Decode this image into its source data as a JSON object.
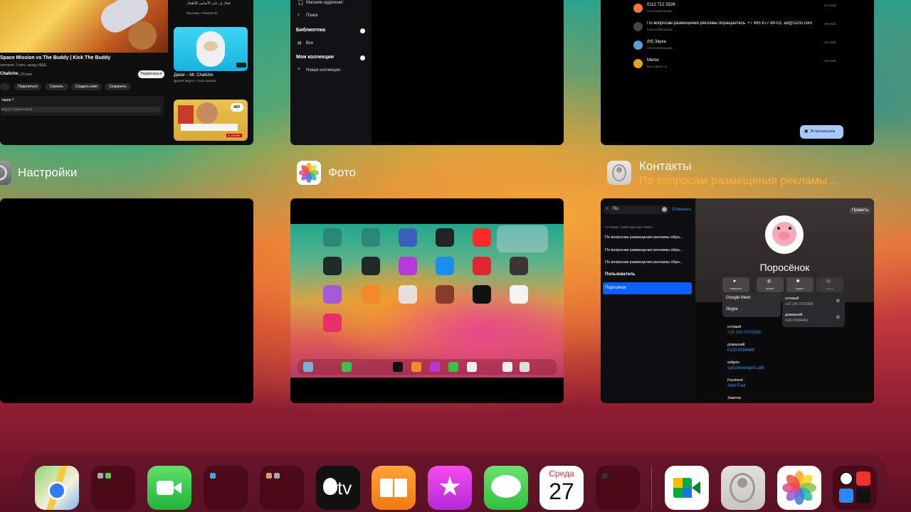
{
  "apps": {
    "youtube": {
      "video_title": "Space Mission vs The Buddy | Kick The Buddy",
      "video_meta": "смотров: 2 млн, назад #ЩЩ",
      "channel": "Chaliche",
      "channel_subs": "1,29 млн",
      "subscribe": "Подписаться",
      "actions": [
        "Поделиться",
        "Скачать",
        "Создать клип",
        "Сохранить"
      ],
      "comments": "тарии 7",
      "comment_placeholder": "ведите комментарий",
      "side_top_text": "فعال إن على الأساس للأطفال",
      "side_top_meta": "Реклама • Parasol 00",
      "side_video_title": "Джем – Mr. Chaliche",
      "side_video_meta": "Другие видео с этого канала",
      "live_badge": "В ЭФИРЕ",
      "no_badge": "NO!"
    },
    "books": {
      "menu": [
        "Магазин аудиокниг",
        "Поиск"
      ],
      "library_header": "Библиотека",
      "library_items": [
        "Все"
      ],
      "collections_header": "Мои коллекции",
      "new_collection": "Новая коллекция"
    },
    "phone": {
      "calls": [
        {
          "name": "0112 712 3526",
          "sub": "Голосовой вызов",
          "time": "12 нояб."
        },
        {
          "name": "По вопросам размещения рекламы обращайтесь: +7 495 677-80-03, ad@11ms.com",
          "sub": "Голосовой вызов",
          "time": "25 нояб."
        },
        {
          "name": "(M) Зауха",
          "sub": "Голосовой вызов",
          "time": "10 нояб."
        },
        {
          "name": "Meme",
          "sub": "Без ответа 🔺",
          "time": "23 нояб."
        }
      ],
      "button": "Встреча/вызов"
    },
    "settings": {
      "label": "Настройки"
    },
    "photos": {
      "label": "Фото"
    },
    "contacts": {
      "label": "Контакты",
      "sublabel": "По вопросам размещения рекламы...",
      "search_value": "По",
      "cancel": "Отменить",
      "section_header": "ЛУЧШИЕ СОВПАДЕНИЯ ИМЕН",
      "results": [
        "По вопросам размещения рекламы обра...",
        "По вопросам размещения рекламы обра...",
        "По вопросам размещения рекламы обра..."
      ],
      "user_header": "Пользователь",
      "selected": "Поросёнок",
      "edit": "Править",
      "contact_name": "Поросёнок",
      "action_labels": [
        "написать",
        "вызов",
        "видео",
        "почта"
      ],
      "menu_items": [
        "Google Meet",
        "Skype"
      ],
      "popup_fields": [
        {
          "label": "сотовый",
          "value": "+20 100 0702308"
        },
        {
          "label": "домашний",
          "value": "0100 6584460"
        }
      ],
      "fields": [
        {
          "label": "сотовый",
          "value": "+20 100 0702308"
        },
        {
          "label": "домашний",
          "value": "0100 6584460"
        },
        {
          "label": "widgets",
          "value": "syncmewidgets.plib"
        },
        {
          "label": "Facebook",
          "value": "Adel Fadl"
        },
        {
          "label": "Заметки",
          "value": ""
        }
      ]
    }
  },
  "dock": {
    "calendar_day": "Среда",
    "calendar_date": "27",
    "tv_label": "tv",
    "icons": [
      "maps-icon",
      "folder-icon",
      "facetime-icon",
      "folder-icon",
      "folder-icon",
      "apple-tv-icon",
      "books-icon",
      "itunes-store-icon",
      "messages-icon",
      "calendar-icon",
      "folder-icon",
      "google-meet-icon",
      "contacts-icon",
      "photos-icon",
      "utilities-folder-icon"
    ]
  },
  "colors": {
    "accent_orange": "#ffb13b",
    "link_blue": "#3d8ef0",
    "selection_blue": "#0a60ff"
  }
}
